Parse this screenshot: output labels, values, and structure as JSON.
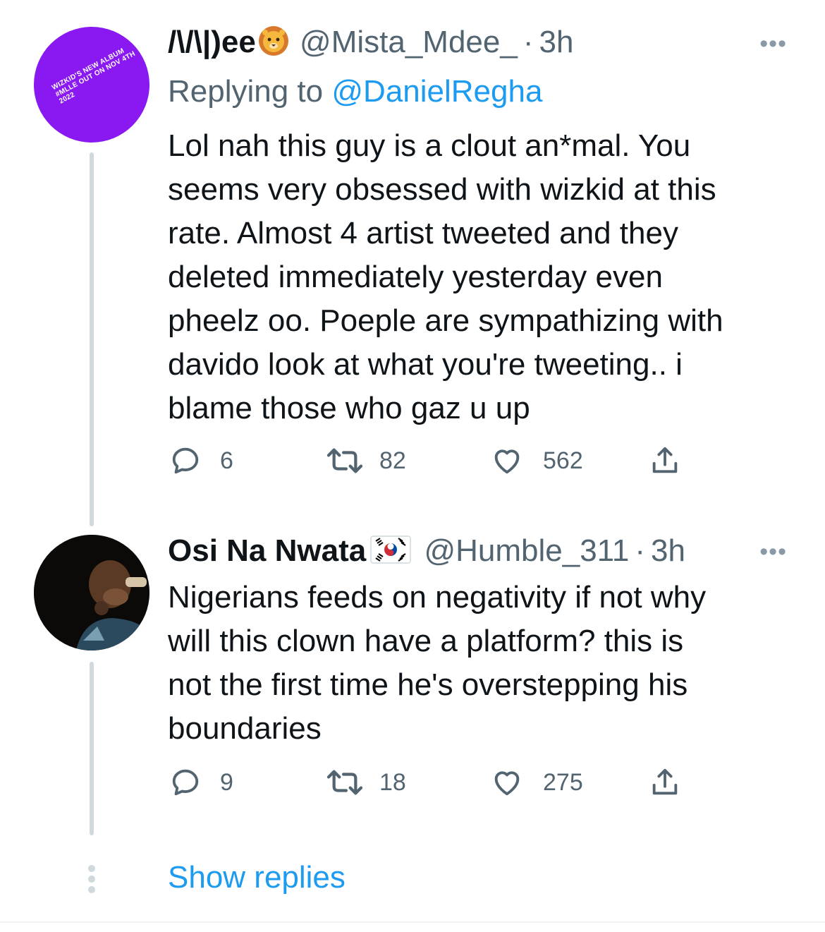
{
  "tweets": [
    {
      "display_name": "/\\/\\|)ee",
      "name_emoji": "lion-face-icon",
      "handle": "@Mista_Mdee_",
      "separator": "·",
      "time": "3h",
      "more_label": "•••",
      "replying_prefix": "Replying to",
      "replying_to": "@DanielRegha",
      "avatar_text": "WIZKID'S NEW ALBUM #MLLE OUT ON NOV 4TH 2022",
      "text_lines": [
        "Lol nah this guy is a clout an*mal. You",
        "seems very obsessed with wizkid at this",
        "rate. Almost 4 artist tweeted and they",
        "deleted immediately yesterday even",
        "pheelz oo. Poeple are sympathizing with",
        "davido look at what you're tweeting.. i",
        "blame those who gaz u up"
      ],
      "replies": "6",
      "retweets": "82",
      "likes": "562"
    },
    {
      "display_name": "Osi Na Nwata",
      "name_emoji": "south-korea-flag-icon",
      "handle": "@Humble_311",
      "separator": "·",
      "time": "3h",
      "more_label": "•••",
      "text_lines": [
        "Nigerians feeds on negativity if not why",
        "will this clown have a platform? this is",
        "not the first time he's overstepping his",
        "boundaries"
      ],
      "replies": "9",
      "retweets": "18",
      "likes": "275"
    }
  ],
  "show_replies_label": "Show replies",
  "colors": {
    "link": "#1d9bf0",
    "secondary_text": "#536471",
    "primary_text": "#0f1419",
    "thread_line": "#cfd9de",
    "avatar_purple": "#8a18f0"
  }
}
